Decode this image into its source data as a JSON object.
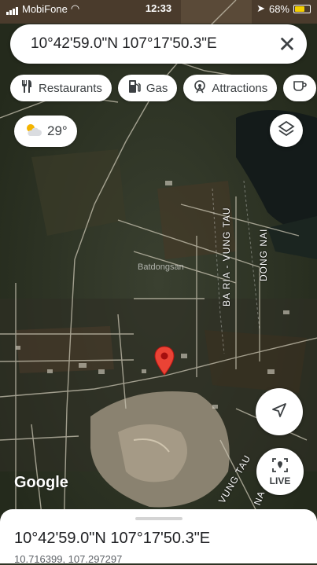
{
  "status_bar": {
    "carrier": "MobiFone",
    "time": "12:33",
    "battery": "68%"
  },
  "search": {
    "query": "10°42'59.0\"N 107°17'50.3\"E"
  },
  "chips": [
    {
      "label": "Restaurants",
      "icon": "fork-knife-icon"
    },
    {
      "label": "Gas",
      "icon": "gas-pump-icon"
    },
    {
      "label": "Attractions",
      "icon": "attractions-icon"
    },
    {
      "label": "",
      "icon": "coffee-icon"
    }
  ],
  "weather": {
    "temp": "29°",
    "icon": "partly-cloudy-icon"
  },
  "map": {
    "road_labels": [
      "BA RIA - VUNG TAU",
      "DONG NAI",
      "VUNG TAU",
      "NA"
    ],
    "watermarks": [
      "Batdongsan",
      "Batdongsan"
    ]
  },
  "live_button": {
    "label": "LIVE"
  },
  "google_logo": "Google",
  "bottom_sheet": {
    "title": "10°42'59.0\"N 107°17'50.3\"E",
    "coordinates": "10.716399, 107.297297"
  },
  "colors": {
    "pin": "#ea4335",
    "accent": "#1a73e8"
  }
}
